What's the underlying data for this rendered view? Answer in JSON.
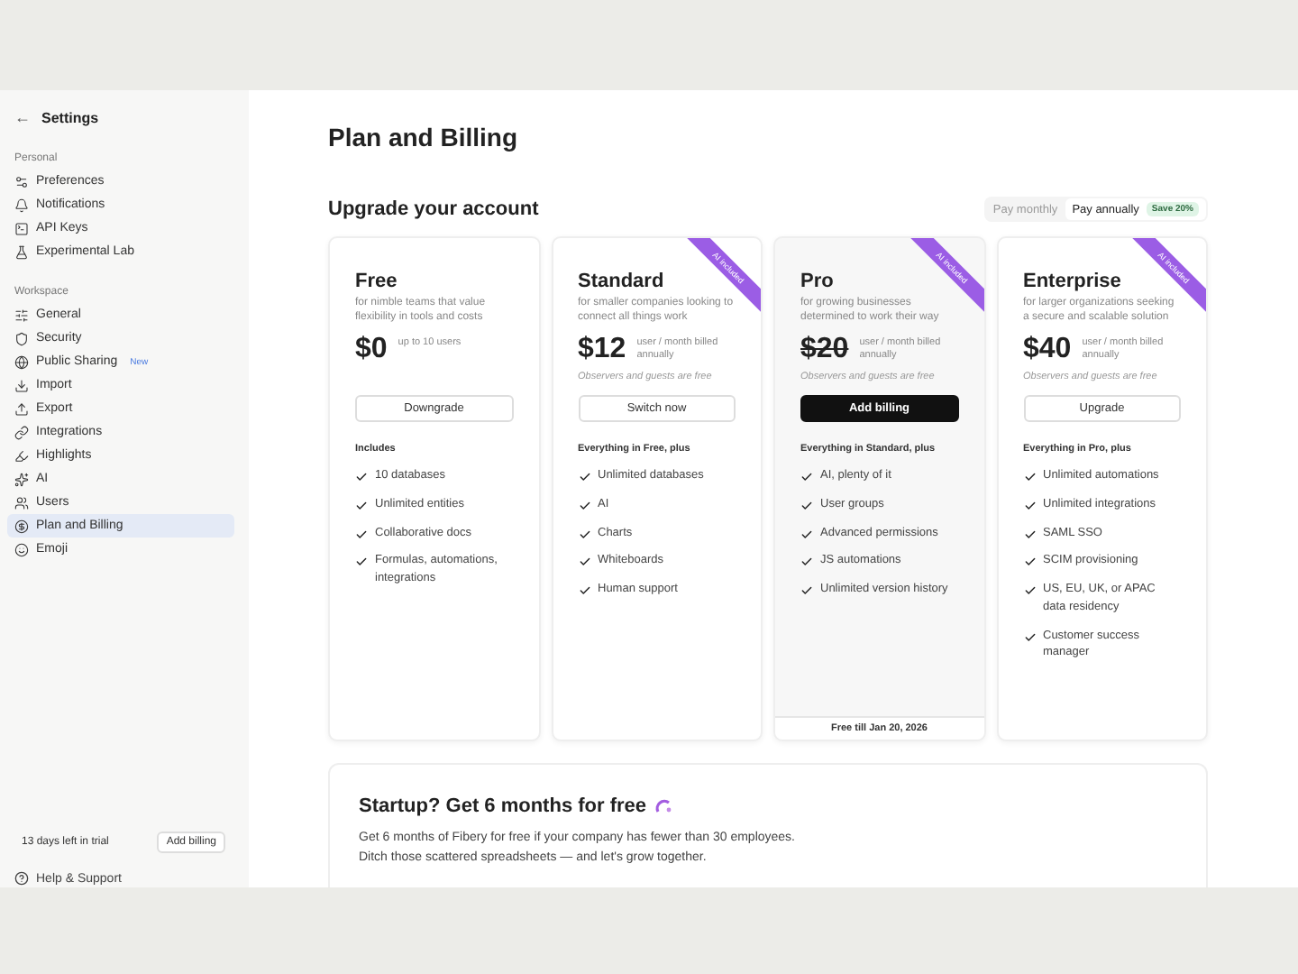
{
  "sidebar": {
    "back": "←",
    "title": "Settings",
    "sections": [
      {
        "heading": "Personal",
        "items": [
          {
            "label": "Preferences",
            "selected": false
          },
          {
            "label": "Notifications",
            "selected": false
          },
          {
            "label": "API Keys",
            "selected": false
          },
          {
            "label": "Experimental Lab",
            "selected": false
          }
        ]
      },
      {
        "heading": "Workspace",
        "items": [
          {
            "label": "General",
            "selected": false
          },
          {
            "label": "Security",
            "selected": false
          },
          {
            "label": "Public Sharing",
            "badge": "New",
            "selected": false
          },
          {
            "label": "Import",
            "selected": false
          },
          {
            "label": "Export",
            "selected": false
          },
          {
            "label": "Integrations",
            "selected": false
          },
          {
            "label": "Highlights",
            "selected": false
          },
          {
            "label": "AI",
            "selected": false
          },
          {
            "label": "Users",
            "selected": false
          },
          {
            "label": "Plan and Billing",
            "selected": true
          },
          {
            "label": "Emoji",
            "selected": false
          }
        ]
      }
    ],
    "trial": {
      "text": "13 days left in trial",
      "button": "Add billing"
    },
    "help": "Help & Support"
  },
  "page": {
    "title": "Plan and Billing",
    "subtitle": "Upgrade your account",
    "billing_toggle": [
      {
        "label": "Pay monthly",
        "selected": false
      },
      {
        "label": "Pay annually",
        "selected": true,
        "badge": "Save 20%"
      }
    ],
    "plans": [
      {
        "name": "Free",
        "description": "for nimble teams that value flexibility in tools and costs",
        "price": "$0",
        "struck": false,
        "price_note": "up to 10 users",
        "button": "Downgrade",
        "selected": false,
        "includes": "Includes",
        "features": [
          "10 databases",
          "Unlimited entities",
          "Collaborative docs",
          "Formulas, automations, integrations"
        ]
      },
      {
        "name": "Standard",
        "ribbon": "AI included",
        "description": "for smaller companies looking to connect all things work",
        "price": "$12",
        "struck": false,
        "price_note": "user / month billed annually",
        "observers": "Observers and guests are free",
        "button": "Switch now",
        "selected": false,
        "includes": "Everything in Free, plus",
        "features": [
          "Unlimited databases",
          "AI",
          "Charts",
          "Whiteboards",
          "Human support"
        ]
      },
      {
        "name": "Pro",
        "ribbon": "AI included",
        "description": "for growing businesses determined to work their way",
        "price": "$20",
        "struck": true,
        "price_note": "user / month billed annually",
        "observers": "Observers and guests are free",
        "button": "Add billing",
        "selected": true,
        "includes": "Everything in Standard, plus",
        "features": [
          "AI, plenty of it",
          "User groups",
          "Advanced permissions",
          "JS automations",
          "Unlimited version history"
        ],
        "footer": "Free till Jan 20, 2026"
      },
      {
        "name": "Enterprise",
        "ribbon": "AI included",
        "description": "for larger organizations seeking a secure and scalable solution",
        "price": "$40",
        "struck": false,
        "price_note": "user / month billed annually",
        "observers": "Observers and guests are free",
        "button": "Upgrade",
        "selected": false,
        "includes": "Everything in Pro, plus",
        "features": [
          "Unlimited automations",
          "Unlimited integrations",
          "SAML SSO",
          "SCIM provisioning",
          "US, EU, UK, or APAC data residency",
          "Customer success manager"
        ]
      }
    ],
    "startup": {
      "title": "Startup? Get 6 months for free",
      "text": "Get 6 months of Fibery for free if your company has fewer than 30 employees.\nDitch those scattered spreadsheets — and let's grow together."
    }
  }
}
